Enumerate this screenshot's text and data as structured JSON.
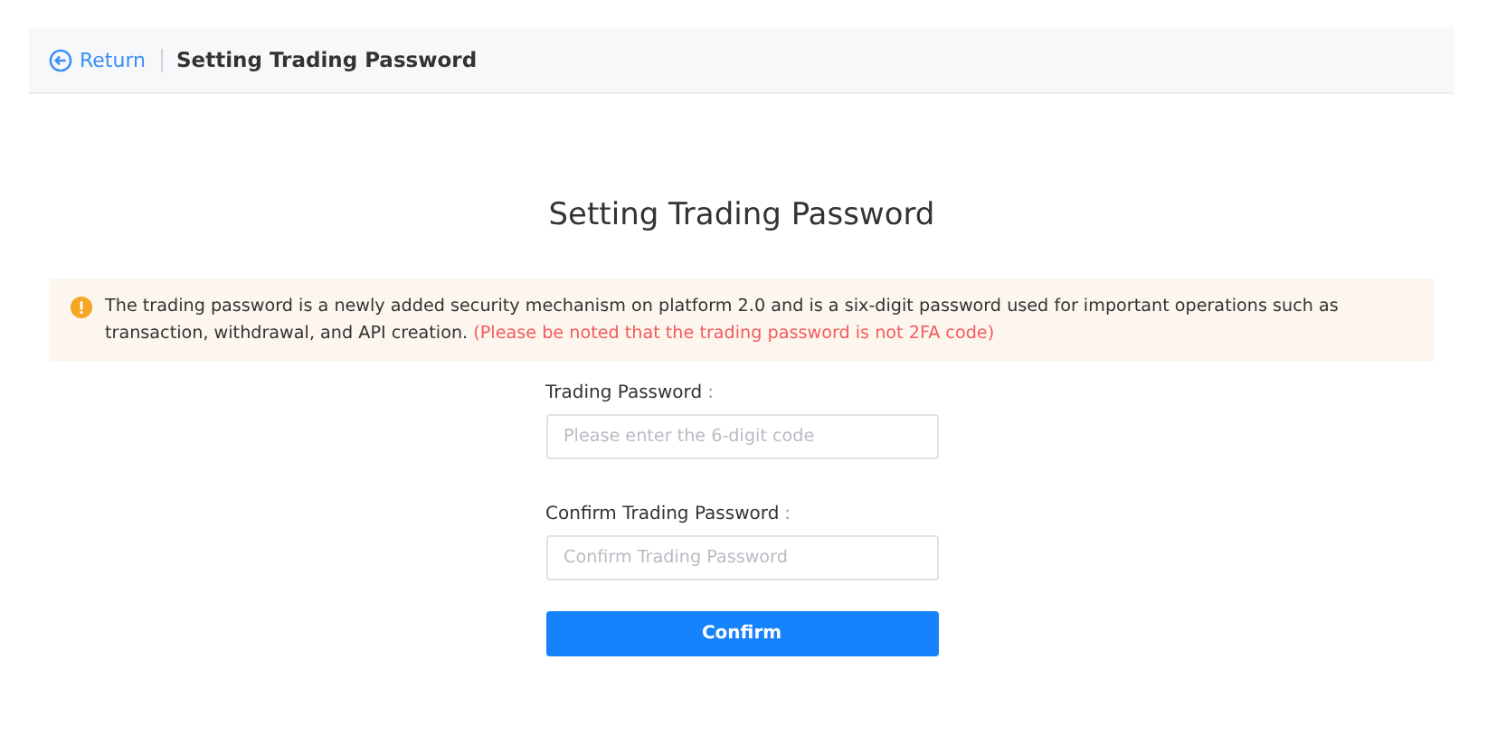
{
  "header": {
    "back_link": "Return",
    "title": "Setting Trading Password"
  },
  "page_title": "Setting Trading Password",
  "notice": {
    "text": "The trading password is a newly added security mechanism on platform 2.0 and is a six-digit password used for important operations such as transaction, withdrawal, and API creation.",
    "warning": "(Please be noted that the trading password is not 2FA code)"
  },
  "fields": [
    {
      "label": "Trading Password",
      "colon": ":",
      "placeholder": "Please enter the 6-digit code"
    },
    {
      "label": "Confirm Trading Password",
      "colon": ":",
      "placeholder": "Confirm Trading Password"
    }
  ],
  "button": "Confirm"
}
